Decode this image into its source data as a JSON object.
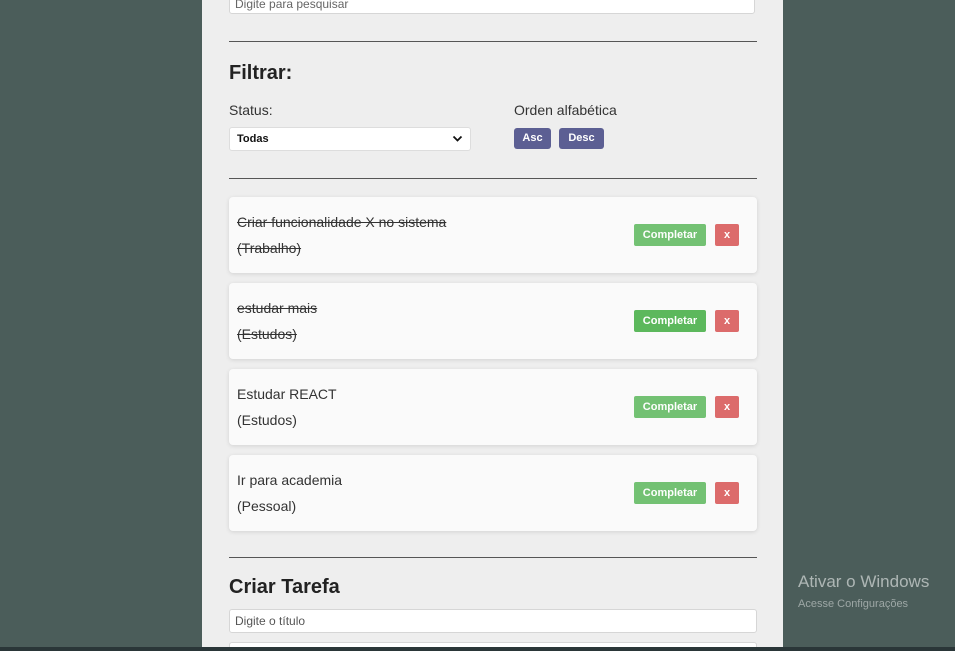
{
  "search": {
    "placeholder": "Digite para pesquisar"
  },
  "filter": {
    "heading": "Filtrar:",
    "status_label": "Status:",
    "status_selected": "Todas",
    "sort_label": "Orden alfabética",
    "asc_label": "Asc",
    "desc_label": "Desc"
  },
  "todos": [
    {
      "title": "Criar funcionalidade X no sistema",
      "category": "(Trabalho)",
      "completed": true
    },
    {
      "title": "estudar mais",
      "category": "(Estudos)",
      "completed": true
    },
    {
      "title": "Estudar REACT",
      "category": "(Estudos)",
      "completed": false
    },
    {
      "title": "Ir para academia",
      "category": "(Pessoal)",
      "completed": false
    }
  ],
  "actions": {
    "complete_label": "Completar",
    "delete_label": "x"
  },
  "create": {
    "heading": "Criar Tarefa",
    "title_placeholder": "Digite o título"
  },
  "watermark": {
    "line1": "Ativar o Windows",
    "line2": "Acesse Configurações"
  },
  "colors": {
    "background": "#4b5d5a",
    "panel": "#eeeeee",
    "complete_button": "#5cb85c",
    "delete_button": "#dc6b6b",
    "sort_button": "#5c5f93"
  }
}
